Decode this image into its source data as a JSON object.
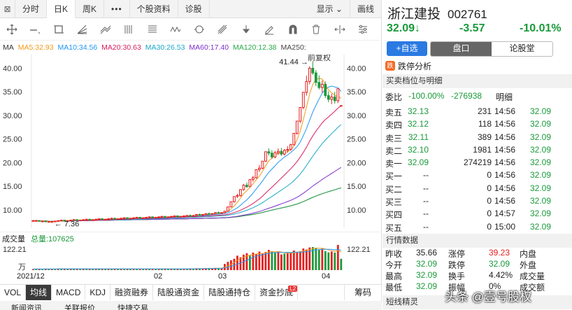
{
  "tabs": [
    "分时",
    "日K",
    "周K",
    "•••",
    "个股资料",
    "诊股",
    "显示",
    "画线"
  ],
  "tabs_close": "⊠",
  "ma_legend": [
    {
      "label": "MA",
      "color": "#333333"
    },
    {
      "label": "MA5:32.93",
      "color": "#f09a1c"
    },
    {
      "label": "MA10:34.56",
      "color": "#2196f3"
    },
    {
      "label": "MA20:30.63",
      "color": "#d81b60"
    },
    {
      "label": "MA30:26.53",
      "color": "#1aa8c8"
    },
    {
      "label": "MA60:17.40",
      "color": "#7b2ecc"
    },
    {
      "label": "MA120:12.38",
      "color": "#2aa84a"
    },
    {
      "label": "MA250:",
      "color": "#444444"
    }
  ],
  "overlay_labels": {
    "restore": "前复权",
    "peak": "41.44",
    "low": "7.36"
  },
  "y_axis_left": [
    "40.00",
    "35.00",
    "30.00",
    "25.00",
    "20.00",
    "15.00",
    "10.00"
  ],
  "y_axis_right": [
    "40.00",
    "35.00",
    "30.00",
    "25.00",
    "20.00",
    "15.00",
    "10.00"
  ],
  "volume": {
    "label": "成交量",
    "total_label": "总量:107625",
    "max_left": "122.21",
    "unit": "万",
    "max_right": "122.21"
  },
  "dates": [
    "2021/12",
    "02",
    "03",
    "04"
  ],
  "indicator_tabs": [
    "VOL",
    "均线",
    "MACD",
    "KDJ",
    "融资融券",
    "陆股通资金",
    "陆股通持仓",
    "资金抄底"
  ],
  "indicator_badge": "L2",
  "indicator_right": "筹码",
  "bottom_tabs": [
    "新闻资讯",
    "关联报价",
    "快捷交易"
  ],
  "stock": {
    "name": "浙江建投",
    "code": "002761",
    "price": "32.09",
    "arrow": "↓",
    "change": "-3.57",
    "change_pct": "-10.01%"
  },
  "actions": {
    "add": "+自选",
    "pankou": "盘口",
    "forum": "论股堂"
  },
  "limit_analysis": {
    "icon": "跌",
    "label": "跌停分析"
  },
  "section_book": "买卖档位与明细",
  "weibi": {
    "label": "委比",
    "value": "-100.00%",
    "diff": "-276938",
    "detail": "明细"
  },
  "order_book": [
    {
      "label": "卖五",
      "price": "32.13",
      "vol": "231"
    },
    {
      "label": "卖四",
      "price": "32.12",
      "vol": "118"
    },
    {
      "label": "卖三",
      "price": "32.11",
      "vol": "389"
    },
    {
      "label": "卖二",
      "price": "32.10",
      "vol": "1981"
    },
    {
      "label": "卖一",
      "price": "32.09",
      "vol": "274219"
    },
    {
      "label": "买一",
      "price": "--",
      "vol": "0"
    },
    {
      "label": "买二",
      "price": "--",
      "vol": "0"
    },
    {
      "label": "买三",
      "price": "--",
      "vol": "0"
    },
    {
      "label": "买四",
      "price": "--",
      "vol": "0"
    },
    {
      "label": "买五",
      "price": "--",
      "vol": "0"
    }
  ],
  "ticks": [
    {
      "time": "14:56",
      "price": "32.09"
    },
    {
      "time": "14:56",
      "price": "32.09"
    },
    {
      "time": "14:56",
      "price": "32.09"
    },
    {
      "time": "14:56",
      "price": "32.09"
    },
    {
      "time": "14:56",
      "price": "32.09"
    },
    {
      "time": "14:56",
      "price": "32.09"
    },
    {
      "time": "14:56",
      "price": "32.09"
    },
    {
      "time": "14:56",
      "price": "32.09"
    },
    {
      "time": "14:57",
      "price": "32.09"
    },
    {
      "time": "15:00",
      "price": "32.09"
    }
  ],
  "section_stats": "行情数据",
  "stats": [
    {
      "l1": "昨收",
      "v1": "35.66",
      "l2": "涨停",
      "v2": "39.23",
      "l3": "内盘",
      "c1": "#222222",
      "c2": "#e62020"
    },
    {
      "l1": "今开",
      "v1": "32.09",
      "l2": "跌停",
      "v2": "32.09",
      "l3": "外盘",
      "c1": "#1a9a3a",
      "c2": "#1a9a3a"
    },
    {
      "l1": "最高",
      "v1": "32.09",
      "l2": "换手",
      "v2": "4.42%",
      "l3": "成交量",
      "c1": "#1a9a3a",
      "c2": "#222222"
    },
    {
      "l1": "最低",
      "v1": "32.09",
      "l2": "振幅",
      "v2": "0%",
      "l3": "成交额",
      "c1": "#1a9a3a",
      "c2": "#222222"
    }
  ],
  "section_short": "短线精灵",
  "watermark": "头条 @壹号股权",
  "chart_data": {
    "type": "candlestick",
    "ylim": [
      7,
      42
    ],
    "x_ticks": [
      "2021/12",
      "02",
      "03",
      "04"
    ],
    "annotations": [
      {
        "text": "41.44",
        "value": 41.44
      },
      {
        "text": "7.36",
        "value": 7.36
      }
    ],
    "candles": [
      [
        7.7,
        7.8,
        7.6,
        7.7
      ],
      [
        7.7,
        7.8,
        7.6,
        7.7
      ],
      [
        7.7,
        7.8,
        7.5,
        7.6
      ],
      [
        7.6,
        7.7,
        7.5,
        7.6
      ],
      [
        7.6,
        7.7,
        7.4,
        7.5
      ],
      [
        7.5,
        7.6,
        7.36,
        7.5
      ],
      [
        7.5,
        7.6,
        7.4,
        7.5
      ],
      [
        7.5,
        7.7,
        7.4,
        7.6
      ],
      [
        7.6,
        7.8,
        7.5,
        7.7
      ],
      [
        7.7,
        7.9,
        7.6,
        7.8
      ],
      [
        7.8,
        7.9,
        7.6,
        7.7
      ],
      [
        7.7,
        7.8,
        7.6,
        7.7
      ],
      [
        7.7,
        7.9,
        7.6,
        7.8
      ],
      [
        7.8,
        8.0,
        7.7,
        7.9
      ],
      [
        7.9,
        8.0,
        7.7,
        7.8
      ],
      [
        7.8,
        7.9,
        7.7,
        7.8
      ],
      [
        7.8,
        8.0,
        7.7,
        7.9
      ],
      [
        7.9,
        8.1,
        7.8,
        8.0
      ],
      [
        8.0,
        8.1,
        7.8,
        7.9
      ],
      [
        7.9,
        8.0,
        7.8,
        7.9
      ],
      [
        7.9,
        8.1,
        7.8,
        8.0
      ],
      [
        8.0,
        8.2,
        7.9,
        8.1
      ],
      [
        8.1,
        8.2,
        7.9,
        8.0
      ],
      [
        8.0,
        8.1,
        7.9,
        8.0
      ],
      [
        8.0,
        8.2,
        7.9,
        8.1
      ],
      [
        8.1,
        8.3,
        8.0,
        8.2
      ],
      [
        8.2,
        8.3,
        8.0,
        8.1
      ],
      [
        8.1,
        8.2,
        8.0,
        8.1
      ],
      [
        8.1,
        8.3,
        8.0,
        8.2
      ],
      [
        8.2,
        8.4,
        8.1,
        8.3
      ],
      [
        8.3,
        8.4,
        8.1,
        8.2
      ],
      [
        8.2,
        8.3,
        8.1,
        8.2
      ],
      [
        8.2,
        8.4,
        8.1,
        8.3
      ],
      [
        8.3,
        8.5,
        8.2,
        8.4
      ],
      [
        8.4,
        8.5,
        8.2,
        8.3
      ],
      [
        8.3,
        8.4,
        8.2,
        8.3
      ],
      [
        8.3,
        8.5,
        8.2,
        8.4
      ],
      [
        8.4,
        8.6,
        8.3,
        8.5
      ],
      [
        8.5,
        8.6,
        8.3,
        8.4
      ],
      [
        8.4,
        8.5,
        8.3,
        8.4
      ],
      [
        8.4,
        8.6,
        8.3,
        8.5
      ],
      [
        8.5,
        8.7,
        8.4,
        8.6
      ],
      [
        8.6,
        8.7,
        8.4,
        8.5
      ],
      [
        8.5,
        8.6,
        8.4,
        8.5
      ],
      [
        8.5,
        8.7,
        8.4,
        8.6
      ],
      [
        8.6,
        8.8,
        8.5,
        8.7
      ],
      [
        8.7,
        8.8,
        8.5,
        8.6
      ],
      [
        8.6,
        8.7,
        8.5,
        8.6
      ],
      [
        8.6,
        8.8,
        8.5,
        8.7
      ],
      [
        8.7,
        8.9,
        8.6,
        8.8
      ],
      [
        8.8,
        9.0,
        8.6,
        8.7
      ],
      [
        8.7,
        8.9,
        8.6,
        8.8
      ],
      [
        8.8,
        9.1,
        8.7,
        9.0
      ],
      [
        9.0,
        9.2,
        8.8,
        8.9
      ],
      [
        8.9,
        9.1,
        8.8,
        9.0
      ],
      [
        9.0,
        9.3,
        8.9,
        9.2
      ],
      [
        9.2,
        9.4,
        9.0,
        9.1
      ],
      [
        9.1,
        9.3,
        9.0,
        9.2
      ],
      [
        9.2,
        9.5,
        9.1,
        9.4
      ],
      [
        9.4,
        9.6,
        9.2,
        9.3
      ],
      [
        9.3,
        9.5,
        9.2,
        9.4
      ],
      [
        9.4,
        9.8,
        9.3,
        9.7
      ],
      [
        9.7,
        10.6,
        9.6,
        10.6
      ],
      [
        10.6,
        11.7,
        10.5,
        11.7
      ],
      [
        11.7,
        12.8,
        11.5,
        12.8
      ],
      [
        12.8,
        13.4,
        12.5,
        13.0
      ],
      [
        13.0,
        14.3,
        12.8,
        14.3
      ],
      [
        14.3,
        15.5,
        14.0,
        15.2
      ],
      [
        15.2,
        15.8,
        14.6,
        14.9
      ],
      [
        14.9,
        16.4,
        14.8,
        16.4
      ],
      [
        16.4,
        17.2,
        16.0,
        16.8
      ],
      [
        16.8,
        18.5,
        16.6,
        18.5
      ],
      [
        18.5,
        19.5,
        18.0,
        18.8
      ],
      [
        18.8,
        20.3,
        18.6,
        20.3
      ],
      [
        20.3,
        22.3,
        20.1,
        22.3
      ],
      [
        22.3,
        23.0,
        21.5,
        22.0
      ],
      [
        22.0,
        22.6,
        20.8,
        21.2
      ],
      [
        21.2,
        22.5,
        20.9,
        22.1
      ],
      [
        22.1,
        23.0,
        21.6,
        22.4
      ],
      [
        22.4,
        23.1,
        21.4,
        21.8
      ],
      [
        21.8,
        22.9,
        21.5,
        22.6
      ],
      [
        22.6,
        23.5,
        22.1,
        22.8
      ],
      [
        22.8,
        24.0,
        22.5,
        23.8
      ],
      [
        23.8,
        26.2,
        23.6,
        26.2
      ],
      [
        26.2,
        28.8,
        25.9,
        28.8
      ],
      [
        28.8,
        31.7,
        28.4,
        31.7
      ],
      [
        31.7,
        34.9,
        31.3,
        34.9
      ],
      [
        34.9,
        38.4,
        34.2,
        37.2
      ],
      [
        37.2,
        40.4,
        36.6,
        40.0
      ],
      [
        40.0,
        41.44,
        38.6,
        39.0
      ],
      [
        39.0,
        39.6,
        36.2,
        37.0
      ],
      [
        37.0,
        38.5,
        35.5,
        35.9
      ],
      [
        35.9,
        37.4,
        34.8,
        36.6
      ],
      [
        36.6,
        37.2,
        33.7,
        34.2
      ],
      [
        34.2,
        35.1,
        32.8,
        33.4
      ],
      [
        33.4,
        34.6,
        32.4,
        33.9
      ],
      [
        33.9,
        35.0,
        32.5,
        33.1
      ],
      [
        33.1,
        35.7,
        32.6,
        35.66
      ],
      [
        32.09,
        32.09,
        32.09,
        32.09
      ]
    ],
    "volume": [
      [
        5,
        1
      ],
      [
        6,
        0
      ],
      [
        5,
        1
      ],
      [
        4,
        0
      ],
      [
        7,
        1
      ],
      [
        6,
        0
      ],
      [
        5,
        1
      ],
      [
        6,
        0
      ],
      [
        7,
        1
      ],
      [
        8,
        0
      ],
      [
        6,
        1
      ],
      [
        5,
        0
      ],
      [
        6,
        1
      ],
      [
        7,
        0
      ],
      [
        6,
        1
      ],
      [
        5,
        0
      ],
      [
        6,
        1
      ],
      [
        7,
        0
      ],
      [
        6,
        1
      ],
      [
        5,
        0
      ],
      [
        6,
        1
      ],
      [
        7,
        0
      ],
      [
        6,
        1
      ],
      [
        5,
        0
      ],
      [
        6,
        1
      ],
      [
        7,
        0
      ],
      [
        6,
        1
      ],
      [
        5,
        0
      ],
      [
        6,
        1
      ],
      [
        7,
        0
      ],
      [
        6,
        1
      ],
      [
        5,
        0
      ],
      [
        6,
        1
      ],
      [
        7,
        0
      ],
      [
        6,
        1
      ],
      [
        5,
        0
      ],
      [
        6,
        1
      ],
      [
        7,
        0
      ],
      [
        6,
        1
      ],
      [
        5,
        0
      ],
      [
        6,
        1
      ],
      [
        7,
        0
      ],
      [
        6,
        1
      ],
      [
        5,
        0
      ],
      [
        6,
        1
      ],
      [
        7,
        0
      ],
      [
        6,
        1
      ],
      [
        5,
        0
      ],
      [
        6,
        1
      ],
      [
        7,
        0
      ],
      [
        8,
        1
      ],
      [
        6,
        0
      ],
      [
        9,
        1
      ],
      [
        7,
        0
      ],
      [
        8,
        1
      ],
      [
        10,
        1
      ],
      [
        8,
        0
      ],
      [
        9,
        1
      ],
      [
        11,
        1
      ],
      [
        9,
        0
      ],
      [
        10,
        1
      ],
      [
        30,
        1
      ],
      [
        40,
        1
      ],
      [
        48,
        1
      ],
      [
        55,
        1
      ],
      [
        70,
        1
      ],
      [
        62,
        1
      ],
      [
        75,
        1
      ],
      [
        82,
        1
      ],
      [
        70,
        0
      ],
      [
        85,
        1
      ],
      [
        78,
        1
      ],
      [
        90,
        1
      ],
      [
        80,
        1
      ],
      [
        88,
        1
      ],
      [
        98,
        1
      ],
      [
        92,
        0
      ],
      [
        85,
        0
      ],
      [
        88,
        1
      ],
      [
        76,
        1
      ],
      [
        80,
        0
      ],
      [
        84,
        1
      ],
      [
        86,
        1
      ],
      [
        95,
        1
      ],
      [
        88,
        1
      ],
      [
        92,
        1
      ],
      [
        105,
        1
      ],
      [
        100,
        1
      ],
      [
        110,
        1
      ],
      [
        112,
        0
      ],
      [
        108,
        0
      ],
      [
        98,
        0
      ],
      [
        104,
        1
      ],
      [
        92,
        0
      ],
      [
        86,
        0
      ],
      [
        90,
        1
      ],
      [
        85,
        0
      ],
      [
        122.21,
        1
      ],
      [
        55,
        0
      ]
    ]
  }
}
